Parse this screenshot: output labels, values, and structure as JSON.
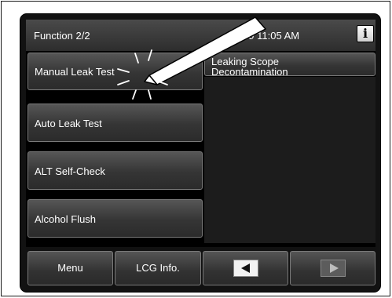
{
  "header": {
    "title": "Function 2/2",
    "datetime": "07/09 11:05 AM",
    "info_label": "i"
  },
  "functions": {
    "manual_leak_test": "Manual Leak Test",
    "leaking_scope_line1": "Leaking Scope",
    "leaking_scope_line2": "Decontamination",
    "auto_leak_test": "Auto Leak Test",
    "alt_self_check": "ALT Self-Check",
    "alcohol_flush": "Alcohol Flush"
  },
  "nav": {
    "menu_label": "Menu",
    "lcg_info_label": "LCG Info.",
    "prev_icon": "left-arrow-icon",
    "next_icon": "right-arrow-icon"
  },
  "colors": {
    "button_face": "#353535",
    "header_bg": "#3a3a3a",
    "screen_bg": "#000000"
  }
}
